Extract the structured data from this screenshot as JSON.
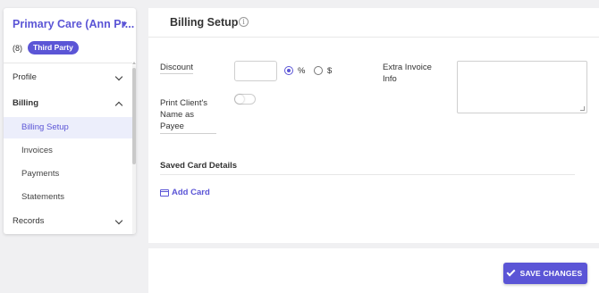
{
  "client": {
    "name": "Primary Care (Ann Pr...",
    "count": "(8)",
    "badge": "Third Party"
  },
  "sidebar": {
    "items": [
      {
        "label": "Profile"
      },
      {
        "label": "Billing"
      },
      {
        "label": "Billing Setup"
      },
      {
        "label": "Invoices"
      },
      {
        "label": "Payments"
      },
      {
        "label": "Statements"
      },
      {
        "label": "Records"
      }
    ]
  },
  "page": {
    "title": "Billing Setup"
  },
  "form": {
    "discount_label": "Discount",
    "discount_value": "",
    "percent_label": "%",
    "dollar_label": "$",
    "extra_invoice_label": "Extra Invoice Info",
    "extra_invoice_value": "",
    "print_name_label": "Print Client's Name as Payee",
    "print_name_line1": "Print Client's",
    "print_name_line2": "Name as",
    "print_name_line3": "Payee",
    "print_name_enabled": false,
    "extra_line1": "Extra Invoice",
    "extra_line2": "Info"
  },
  "saved_cards": {
    "title": "Saved Card Details",
    "add_label": "Add Card"
  },
  "footer": {
    "save_label": "SAVE CHANGES"
  },
  "colors": {
    "accent": "#5b55d6",
    "active_bg": "#eceefb"
  }
}
